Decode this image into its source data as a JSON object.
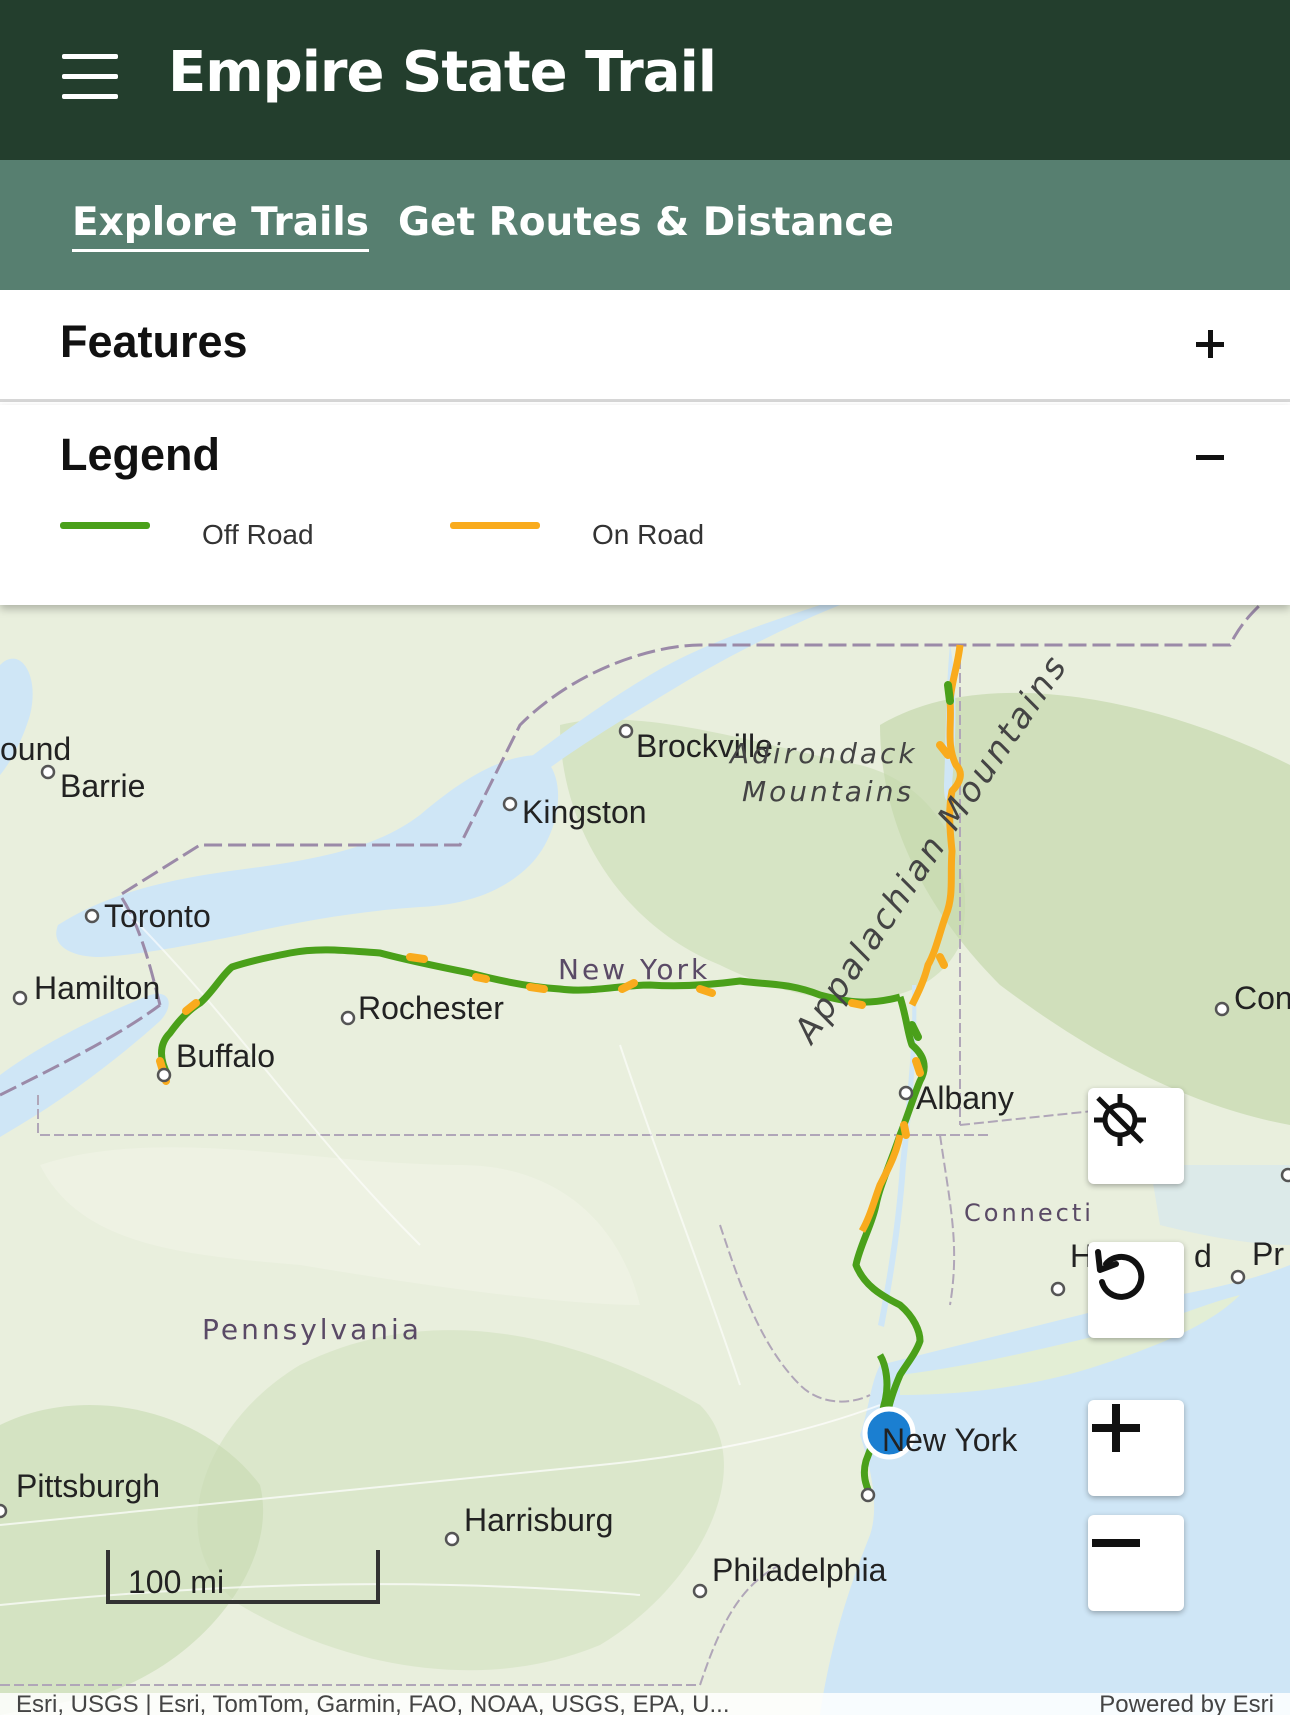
{
  "app": {
    "title": "Empire State Trail"
  },
  "tabs": [
    {
      "label": "Explore Trails",
      "active": true
    },
    {
      "label": "Get Routes & Distance",
      "active": false
    }
  ],
  "features": {
    "title": "Features",
    "state": "collapsed"
  },
  "legend": {
    "title": "Legend",
    "state": "expanded",
    "items": [
      {
        "label": "Off Road",
        "color": "#4aa01a"
      },
      {
        "label": "On Road",
        "color": "#f9ab1d"
      }
    ]
  },
  "map": {
    "labels": {
      "barrie": "Barrie",
      "sound": "ound",
      "brockville": "Brockville",
      "kingston": "Kingston",
      "adirondack_1": "Adirondack",
      "adirondack_2": "Mountains",
      "toronto": "Toronto",
      "hamilton": "Hamilton",
      "rochester": "Rochester",
      "buffalo": "Buffalo",
      "new_york_state": "New York",
      "appalachian": "Appalachian Mountains",
      "albany": "Albany",
      "con": "Con",
      "hartford": "H",
      "hartford_end": "d",
      "connecticut": "Connecti",
      "providence": "Pr",
      "pennsylvania": "Pennsylvania",
      "new_york_city": "New York",
      "pittsburgh": "Pittsburgh",
      "harrisburg": "Harrisburg",
      "philadelphia": "Philadelphia"
    },
    "scale": "100 mi",
    "attribution": "Esri, USGS | Esri, TomTom, Garmin, FAO, NOAA, USGS, EPA, U...",
    "powered_by": "Powered by Esri",
    "colors": {
      "water": "#cfe6f6",
      "land": "#e9efdd",
      "off_road": "#4aa01a",
      "on_road": "#f9ab1d",
      "location": "#1b7fd1"
    }
  },
  "controls": {
    "locate_icon": "location-off-icon",
    "reset_icon": "rotate-ccw-icon",
    "zoom_in_icon": "plus-icon",
    "zoom_out_icon": "minus-icon"
  }
}
